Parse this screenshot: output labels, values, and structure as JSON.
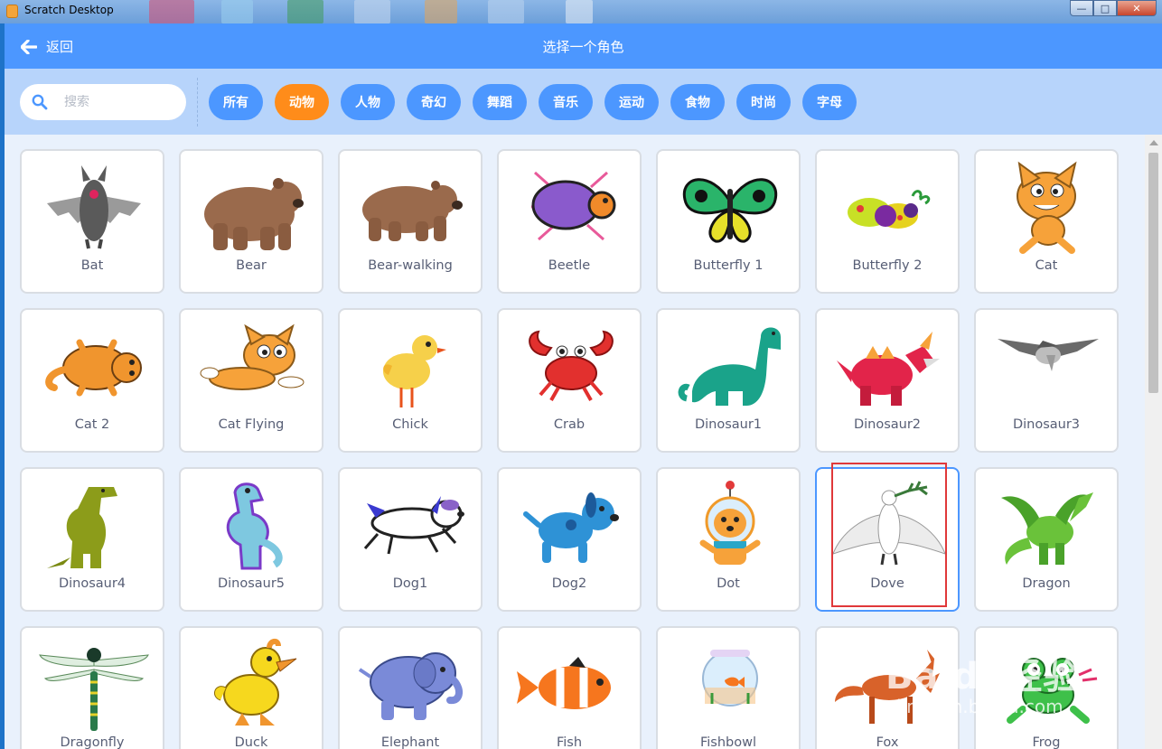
{
  "window": {
    "title": "Scratch Desktop"
  },
  "header": {
    "back_label": "返回",
    "title": "选择一个角色"
  },
  "search": {
    "placeholder": "搜索",
    "value": ""
  },
  "tags": [
    {
      "label": "所有",
      "active": false
    },
    {
      "label": "动物",
      "active": true
    },
    {
      "label": "人物",
      "active": false
    },
    {
      "label": "奇幻",
      "active": false
    },
    {
      "label": "舞蹈",
      "active": false
    },
    {
      "label": "音乐",
      "active": false
    },
    {
      "label": "运动",
      "active": false
    },
    {
      "label": "食物",
      "active": false
    },
    {
      "label": "时尚",
      "active": false
    },
    {
      "label": "字母",
      "active": false
    }
  ],
  "sprites": [
    {
      "name": "Bat",
      "icon": "bat-icon"
    },
    {
      "name": "Bear",
      "icon": "bear-icon"
    },
    {
      "name": "Bear-walking",
      "icon": "bear-walking-icon"
    },
    {
      "name": "Beetle",
      "icon": "beetle-icon"
    },
    {
      "name": "Butterfly 1",
      "icon": "butterfly-icon"
    },
    {
      "name": "Butterfly 2",
      "icon": "butterfly2-icon"
    },
    {
      "name": "Cat",
      "icon": "cat-icon"
    },
    {
      "name": "Cat 2",
      "icon": "cat2-icon"
    },
    {
      "name": "Cat Flying",
      "icon": "cat-flying-icon"
    },
    {
      "name": "Chick",
      "icon": "chick-icon"
    },
    {
      "name": "Crab",
      "icon": "crab-icon"
    },
    {
      "name": "Dinosaur1",
      "icon": "dinosaur1-icon"
    },
    {
      "name": "Dinosaur2",
      "icon": "dinosaur2-icon"
    },
    {
      "name": "Dinosaur3",
      "icon": "dinosaur3-icon"
    },
    {
      "name": "Dinosaur4",
      "icon": "dinosaur4-icon"
    },
    {
      "name": "Dinosaur5",
      "icon": "dinosaur5-icon"
    },
    {
      "name": "Dog1",
      "icon": "dog1-icon"
    },
    {
      "name": "Dog2",
      "icon": "dog2-icon"
    },
    {
      "name": "Dot",
      "icon": "dot-icon"
    },
    {
      "name": "Dove",
      "icon": "dove-icon",
      "selected": true
    },
    {
      "name": "Dragon",
      "icon": "dragon-icon"
    },
    {
      "name": "Dragonfly",
      "icon": "dragonfly-icon"
    },
    {
      "name": "Duck",
      "icon": "duck-icon"
    },
    {
      "name": "Elephant",
      "icon": "elephant-icon"
    },
    {
      "name": "Fish",
      "icon": "fish-icon"
    },
    {
      "name": "Fishbowl",
      "icon": "fishbowl-icon"
    },
    {
      "name": "Fox",
      "icon": "fox-icon"
    },
    {
      "name": "Frog",
      "icon": "frog-icon"
    }
  ],
  "watermark": {
    "line1": "Baidu经验",
    "line2": "jingyan.baidu.com"
  },
  "colors": {
    "header": "#4c97ff",
    "active_tag": "#ff8c1a",
    "highlight": "#e0383a"
  }
}
